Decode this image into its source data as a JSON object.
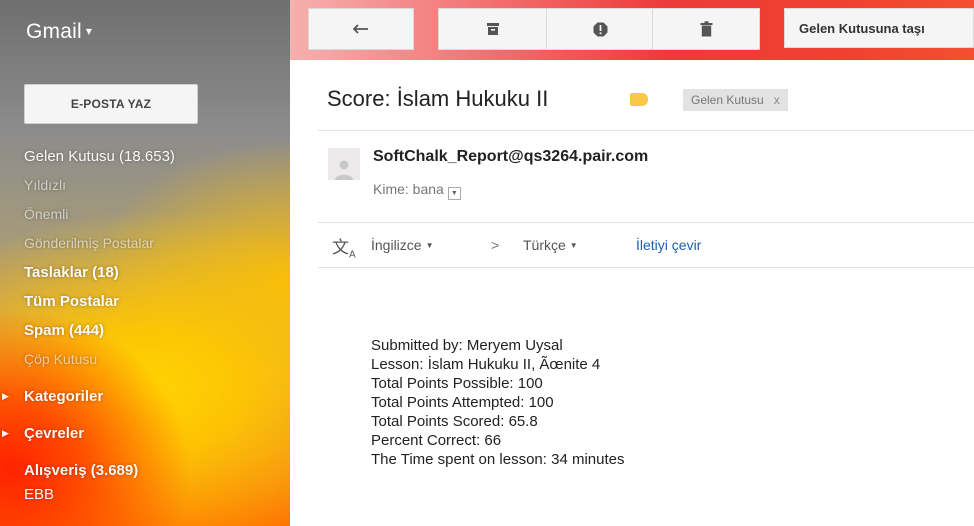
{
  "app": {
    "brand": "Gmail"
  },
  "sidebar": {
    "compose_label": "E-POSTA YAZ",
    "items": [
      {
        "label": "Gelen Kutusu (18.653)"
      },
      {
        "label": "Yıldızlı"
      },
      {
        "label": "Önemli"
      },
      {
        "label": "Gönderilmiş Postalar"
      },
      {
        "label": "Taslaklar (18)"
      },
      {
        "label": "Tüm Postalar"
      },
      {
        "label": "Spam (444)"
      },
      {
        "label": "Çöp Kutusu"
      },
      {
        "label": "Kategoriler"
      },
      {
        "label": "Çevreler"
      },
      {
        "label": "Alışveriş (3.689)"
      },
      {
        "label": "EBB"
      }
    ]
  },
  "toolbar": {
    "back_icon": "reply-arrow-icon",
    "archive_icon": "archive-icon",
    "spam_icon": "report-spam-icon",
    "delete_icon": "trash-icon",
    "move_label": "Gelen Kutusuna taşı"
  },
  "message": {
    "subject": "Score: İslam Hukuku II",
    "inbox_chip": "Gelen Kutusu",
    "chip_close": "x",
    "sender": "SoftChalk_Report@qs3264.pair.com",
    "recipient": "Kime: bana",
    "translate": {
      "source": "İngilizce",
      "arrow": ">",
      "target": "Türkçe",
      "link": "İletiyi çevir"
    },
    "body_lines": [
      "Submitted by: Meryem Uysal",
      "Lesson: İslam Hukuku II, Ãœnite 4",
      "Total Points Possible: 100",
      "Total Points Attempted: 100",
      "Total Points Scored: 65.8",
      "Percent Correct: 66",
      "The Time spent on lesson: 34 minutes"
    ]
  },
  "colors": {
    "label_tag": "#f9c846",
    "link": "#1a5fb4"
  }
}
